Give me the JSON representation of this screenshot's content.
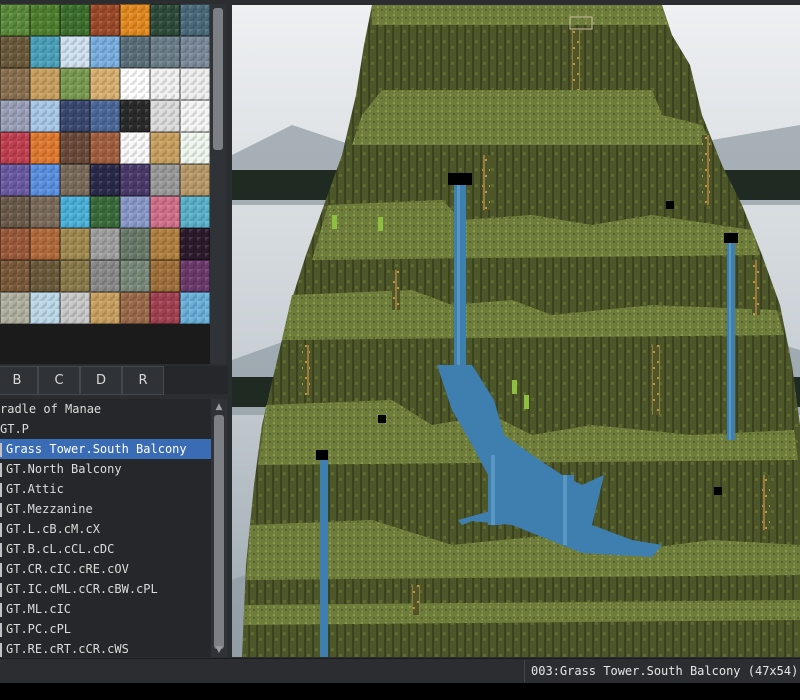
{
  "tileset": {
    "rows": [
      [
        "#5b8a3a",
        "#4f7f2e",
        "#3c6e2c",
        "#9b4a2a",
        "#e08a20",
        "#2e4a3a",
        "#4a6a7a"
      ],
      [
        "#6a5a3a",
        "#4aa0b8",
        "#cfe0ef",
        "#7ab0e0",
        "#5a6e7a",
        "#6a7e8a",
        "#7a8a9a"
      ],
      [
        "#8a7050",
        "#c8a060",
        "#7a9a50",
        "#d8b070",
        "#ffffff",
        "#f0f0f0",
        "#eeeeee"
      ],
      [
        "#9aa0b8",
        "#a8c8e8",
        "#3a4870",
        "#4a6898",
        "#2a2a2a",
        "#dcdcdc",
        "#f4f4f4"
      ],
      [
        "#c04050",
        "#e07a30",
        "#6a4a3a",
        "#a06040",
        "#f8f8f8",
        "#c8a060",
        "#eef6ee"
      ],
      [
        "#6a5aa0",
        "#5a90e0",
        "#7a6a5a",
        "#2a2a4a",
        "#4a3a6a",
        "#9a9a9a",
        "#b89a6a"
      ],
      [
        "#6a5a4a",
        "#7a6a5a",
        "#4ab0d8",
        "#3a6a3a",
        "#8a9ac8",
        "#d0708a",
        "#5ab0c8"
      ],
      [
        "#9a5a3a",
        "#b06a3a",
        "#a08a50",
        "#a0a0a0",
        "#6a7a6a",
        "#b08040",
        "#2a1a2a"
      ],
      [
        "#7a5a3a",
        "#6a5a3a",
        "#8a7a4a",
        "#8a8a8a",
        "#7a8a7a",
        "#a0703a",
        "#6a3a6a"
      ],
      [
        "#b0b0a0",
        "#bcd8e8",
        "#c8c8c8",
        "#c8a060",
        "#9a6a4a",
        "#a04050",
        "#6ab0d8"
      ]
    ]
  },
  "tabs": [
    "B",
    "C",
    "D",
    "R"
  ],
  "map_list": [
    {
      "label": "radle of Manae",
      "depth": 0,
      "selected": false
    },
    {
      "label": "GT.P",
      "depth": 0,
      "selected": false
    },
    {
      "label": "Grass Tower.South Balcony",
      "depth": 1,
      "selected": true
    },
    {
      "label": "GT.North Balcony",
      "depth": 1,
      "selected": false
    },
    {
      "label": "GT.Attic",
      "depth": 1,
      "selected": false
    },
    {
      "label": "GT.Mezzanine",
      "depth": 1,
      "selected": false
    },
    {
      "label": "GT.L.cB.cM.cX",
      "depth": 1,
      "selected": false
    },
    {
      "label": "GT.B.cL.cCL.cDC",
      "depth": 1,
      "selected": false
    },
    {
      "label": "GT.CR.cIC.cRE.cOV",
      "depth": 1,
      "selected": false
    },
    {
      "label": "GT.IC.cML.cCR.cBW.cPL",
      "depth": 1,
      "selected": false
    },
    {
      "label": "GT.ML.cIC",
      "depth": 1,
      "selected": false
    },
    {
      "label": "GT.PC.cPL",
      "depth": 1,
      "selected": false
    },
    {
      "label": "GT.RE.cRT.cCR.cWS",
      "depth": 1,
      "selected": false
    }
  ],
  "status": {
    "text": "003:Grass Tower.South Balcony (47x54)"
  },
  "colors": {
    "selection": "#3a6cb5",
    "grass": "#6b7a3a",
    "cliff": "#4a5226",
    "water": "#3f7fb0",
    "sky": "#d9dde0"
  }
}
